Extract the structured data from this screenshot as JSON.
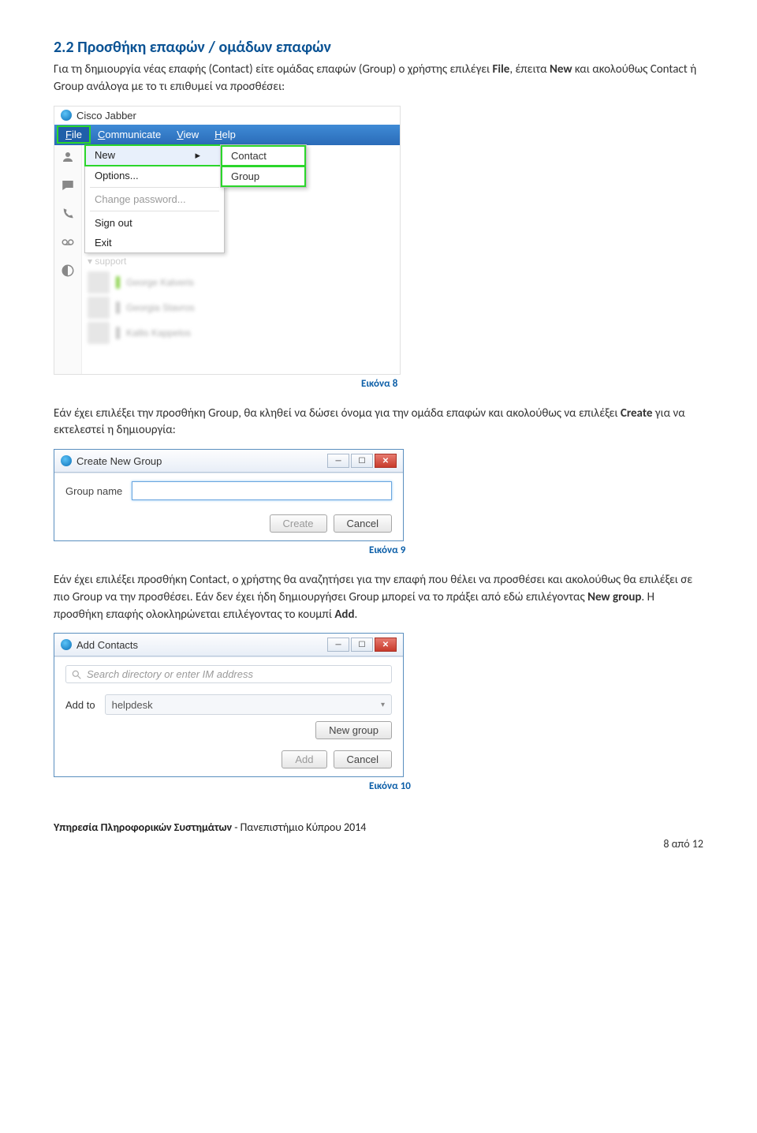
{
  "heading": "2.2 Προσθήκη επαφών / ομάδων επαφών",
  "para1_a": "Για τη δημιουργία νέας επαφής (Contact) είτε ομάδας επαφών (Group) ο χρήστης επιλέγει ",
  "para1_file": "File",
  "para1_b": ", έπειτα ",
  "para1_new": "New",
  "para1_c": " και ακολούθως Contact ή Group ανάλογα με το τι επιθυμεί να προσθέσει:",
  "jabber": {
    "title": "Cisco Jabber",
    "menu": {
      "file": "File",
      "communicate": "Communicate",
      "view": "View",
      "help": "Help"
    },
    "filemenu": {
      "new": "New",
      "options": "Options...",
      "change_password": "Change password...",
      "sign_out": "Sign out",
      "exit": "Exit"
    },
    "submenu": {
      "contact": "Contact",
      "group": "Group"
    },
    "support": "support"
  },
  "caption8": "Εικόνα 8",
  "para2_a": "Εάν έχει επιλέξει την προσθήκη Group, θα κληθεί να δώσει όνομα για την ομάδα επαφών και ακολούθως να επιλέξει ",
  "para2_create": "Create",
  "para2_b": " για να εκτελεστεί η δημιουργία:",
  "dlg1": {
    "title": "Create New Group",
    "label": "Group name",
    "create": "Create",
    "cancel": "Cancel"
  },
  "caption9": "Εικόνα 9",
  "para3_a": "Εάν έχει επιλέξει προσθήκη Contact, ο χρήστης θα αναζητήσει για την επαφή που θέλει να προσθέσει και ακολούθως θα επιλέξει σε πιο Group να την προσθέσει. Εάν δεν έχει ήδη δημιουργήσει Group μπορεί να το πράξει από εδώ επιλέγοντας ",
  "para3_newgroup": "New group",
  "para3_b": ". Η προσθήκη επαφής ολοκληρώνεται επιλέγοντας το κουμπί ",
  "para3_add": "Add",
  "para3_c": ".",
  "dlg2": {
    "title": "Add Contacts",
    "search_ph": "Search directory or enter IM address",
    "addto": "Add to",
    "combo": "helpdesk",
    "newgroup": "New group",
    "add": "Add",
    "cancel": "Cancel"
  },
  "caption10": "Εικόνα 10",
  "footer_a": "Υπηρεσία Πληροφορικών Συστημάτων",
  "footer_b": " - Πανεπιστήμιο Κύπρου 2014",
  "pagenum": "8 από 12"
}
